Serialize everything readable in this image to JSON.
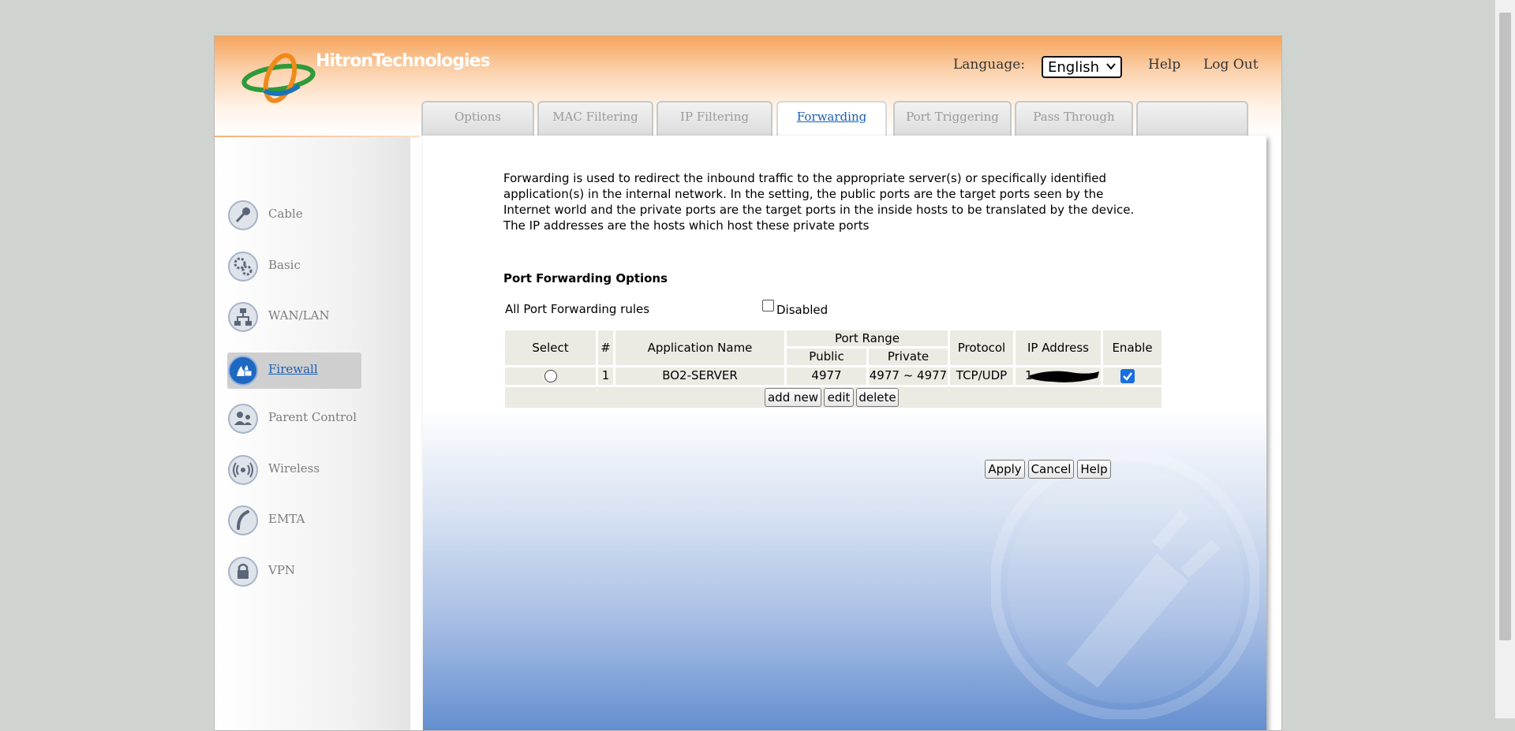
{
  "header": {
    "brand": "HitronTechnologies",
    "language_label": "Language:",
    "language_value": "English",
    "help": "Help",
    "logout": "Log Out"
  },
  "tabs": [
    {
      "label": "Options"
    },
    {
      "label": "MAC Filtering"
    },
    {
      "label": "IP Filtering"
    },
    {
      "label": "Forwarding",
      "active": true
    },
    {
      "label": "Port Triggering"
    },
    {
      "label": "Pass Through"
    },
    {
      "label": ""
    }
  ],
  "sidebar": {
    "items": [
      {
        "label": "Cable",
        "icon": "key-icon"
      },
      {
        "label": "Basic",
        "icon": "gears-icon"
      },
      {
        "label": "WAN/LAN",
        "icon": "network-icon"
      },
      {
        "label": "Firewall",
        "icon": "firewall-icon",
        "active": true
      },
      {
        "label": "Parent Control",
        "icon": "users-icon"
      },
      {
        "label": "Wireless",
        "icon": "wireless-icon"
      },
      {
        "label": "EMTA",
        "icon": "phone-icon"
      },
      {
        "label": "VPN",
        "icon": "lock-icon"
      }
    ]
  },
  "main": {
    "description": "Forwarding is used to redirect the inbound traffic to the appropriate server(s) or specifically identified application(s) in the internal network. In the setting, the public ports are the target ports seen by the Internet world and the private ports are the target ports in the inside hosts to be translated by the device. The IP addresses are the hosts which host these private ports",
    "section_title": "Port Forwarding Options",
    "all_rules_label": "All Port Forwarding rules",
    "disabled_label": "Disabled",
    "disabled_checked": false,
    "table": {
      "headers": {
        "select": "Select",
        "num": "#",
        "app_name": "Application Name",
        "port_range": "Port Range",
        "public": "Public",
        "private": "Private",
        "protocol": "Protocol",
        "ip": "IP Address",
        "enable": "Enable"
      },
      "rows": [
        {
          "num": "1",
          "app_name": "BO2-SERVER",
          "public": "4977",
          "private": "4977 ~ 4977",
          "protocol": "TCP/UDP",
          "ip": "1",
          "enabled": true
        }
      ]
    },
    "buttons": {
      "add_new": "add new",
      "edit": "edit",
      "delete": "delete",
      "apply": "Apply",
      "cancel": "Cancel",
      "help": "Help"
    }
  },
  "colors": {
    "accent_link": "#1a5fb4",
    "header_orange": "#f6a45c",
    "table_cell": "#ebebe3"
  }
}
